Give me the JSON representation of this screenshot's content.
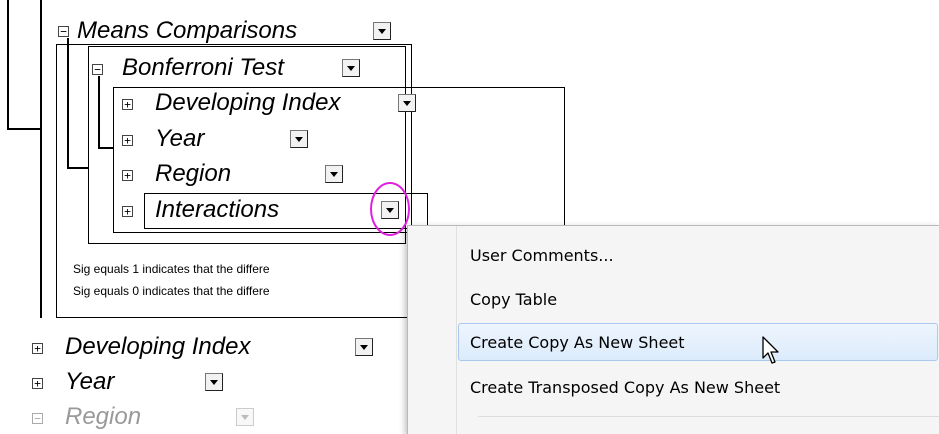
{
  "tree": {
    "means_comparisons": {
      "label": "Means Comparisons",
      "toggle": "−"
    },
    "bonferroni": {
      "label": "Bonferroni Test",
      "toggle": "−"
    },
    "nested_items": [
      {
        "label": "Developing Index",
        "toggle": "+"
      },
      {
        "label": "Year",
        "toggle": "+"
      },
      {
        "label": "Region",
        "toggle": "+"
      },
      {
        "label": "Interactions",
        "toggle": "+"
      }
    ],
    "notes": [
      "Sig equals 1 indicates that the differe",
      "Sig equals 0 indicates that the differe"
    ],
    "outer_items": [
      {
        "label": "Developing Index",
        "toggle": "+"
      },
      {
        "label": "Year",
        "toggle": "+"
      },
      {
        "label": "Region",
        "toggle": "−"
      }
    ]
  },
  "context_menu": {
    "items": [
      {
        "label": "User Comments..."
      },
      {
        "label": "Copy Table"
      },
      {
        "label": "Create Copy As New Sheet",
        "highlighted": true
      },
      {
        "label": "Create Transposed Copy As New Sheet"
      }
    ]
  },
  "colors": {
    "highlight_circle": "#e020e0",
    "menu_hover": "#dcebfc"
  }
}
